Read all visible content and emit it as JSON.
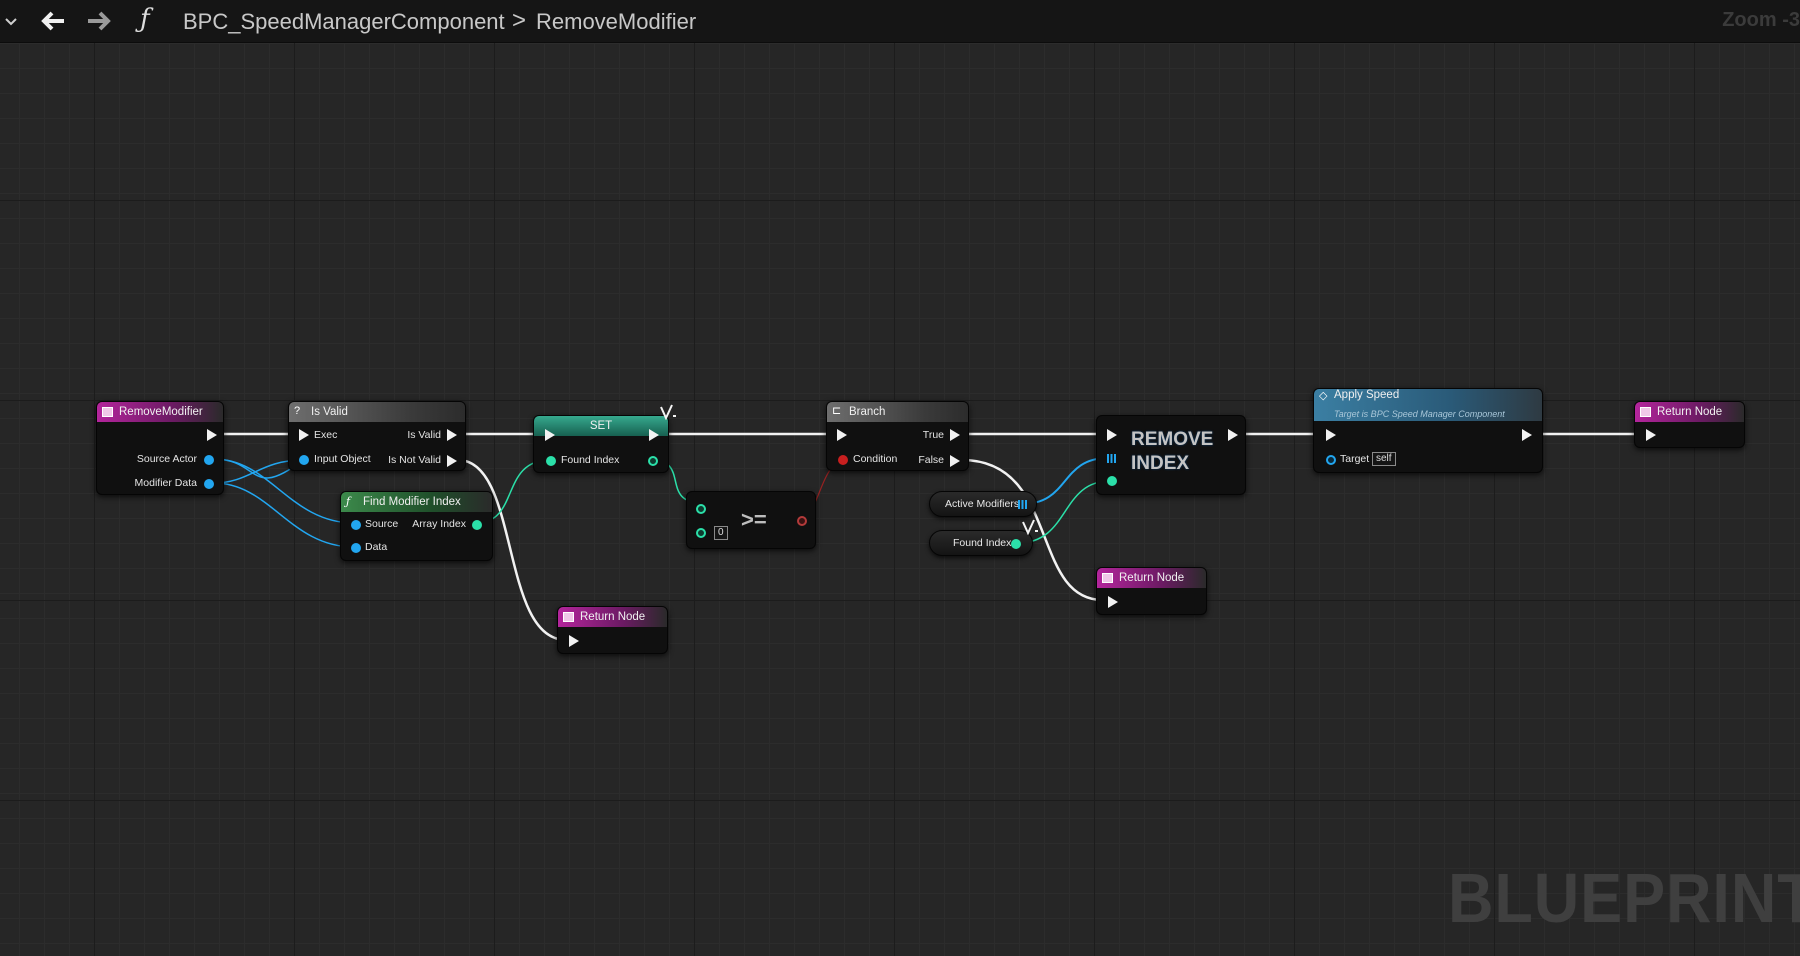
{
  "toolbar": {
    "collapse_icon": "chevron-down-icon",
    "back_icon": "arrow-left-icon",
    "forward_icon": "arrow-right-icon",
    "function_icon": "function-icon",
    "function_glyph": "ƒ",
    "breadcrumb": [
      "BPC_SpeedManagerComponent",
      "RemoveModifier"
    ],
    "separator": ">",
    "zoom": "Zoom -3"
  },
  "watermark": "BLUEPRINT",
  "colors": {
    "exec_wire": "#f2f2f2",
    "object_wire": "#22a6f0",
    "int_wire": "#2be0a9",
    "bool_wire": "#c81f1f",
    "event_header": "#b4259c",
    "call_header": "#3c8a4b",
    "set_header": "#36a98e",
    "member_header": "#3b7fa3"
  },
  "nodes": {
    "entry": {
      "title": "RemoveModifier",
      "outputs": [
        "Source Actor",
        "Modifier Data"
      ]
    },
    "is_valid": {
      "title": "Is Valid",
      "icon_glyph": "?",
      "inputs": [
        "Exec",
        "Input Object"
      ],
      "outputs": [
        "Is Valid",
        "Is Not Valid"
      ]
    },
    "find_modifier": {
      "title": "Find Modifier Index",
      "icon_glyph": "ƒ",
      "inputs": [
        "Source",
        "Data"
      ],
      "outputs": [
        "Array Index"
      ]
    },
    "set": {
      "title": "SET",
      "inputs": [
        "Found Index"
      ]
    },
    "compare": {
      "operator": ">=",
      "default_value": "0"
    },
    "branch": {
      "title": "Branch",
      "icon_glyph": "⊏",
      "inputs": [
        "Condition"
      ],
      "outputs": [
        "True",
        "False"
      ]
    },
    "active_modifiers": {
      "label": "Active Modifiers"
    },
    "found_index_get": {
      "label": "Found Index"
    },
    "remove_index": {
      "title": "REMOVE INDEX"
    },
    "apply_speed": {
      "title": "Apply Speed",
      "icon_glyph": "◇",
      "subtitle": "Target is BPC Speed Manager Component",
      "inputs": [
        "Target"
      ],
      "target_value": "self"
    },
    "return_1": {
      "title": "Return Node"
    },
    "return_2": {
      "title": "Return Node"
    },
    "return_3": {
      "title": "Return Node"
    }
  }
}
